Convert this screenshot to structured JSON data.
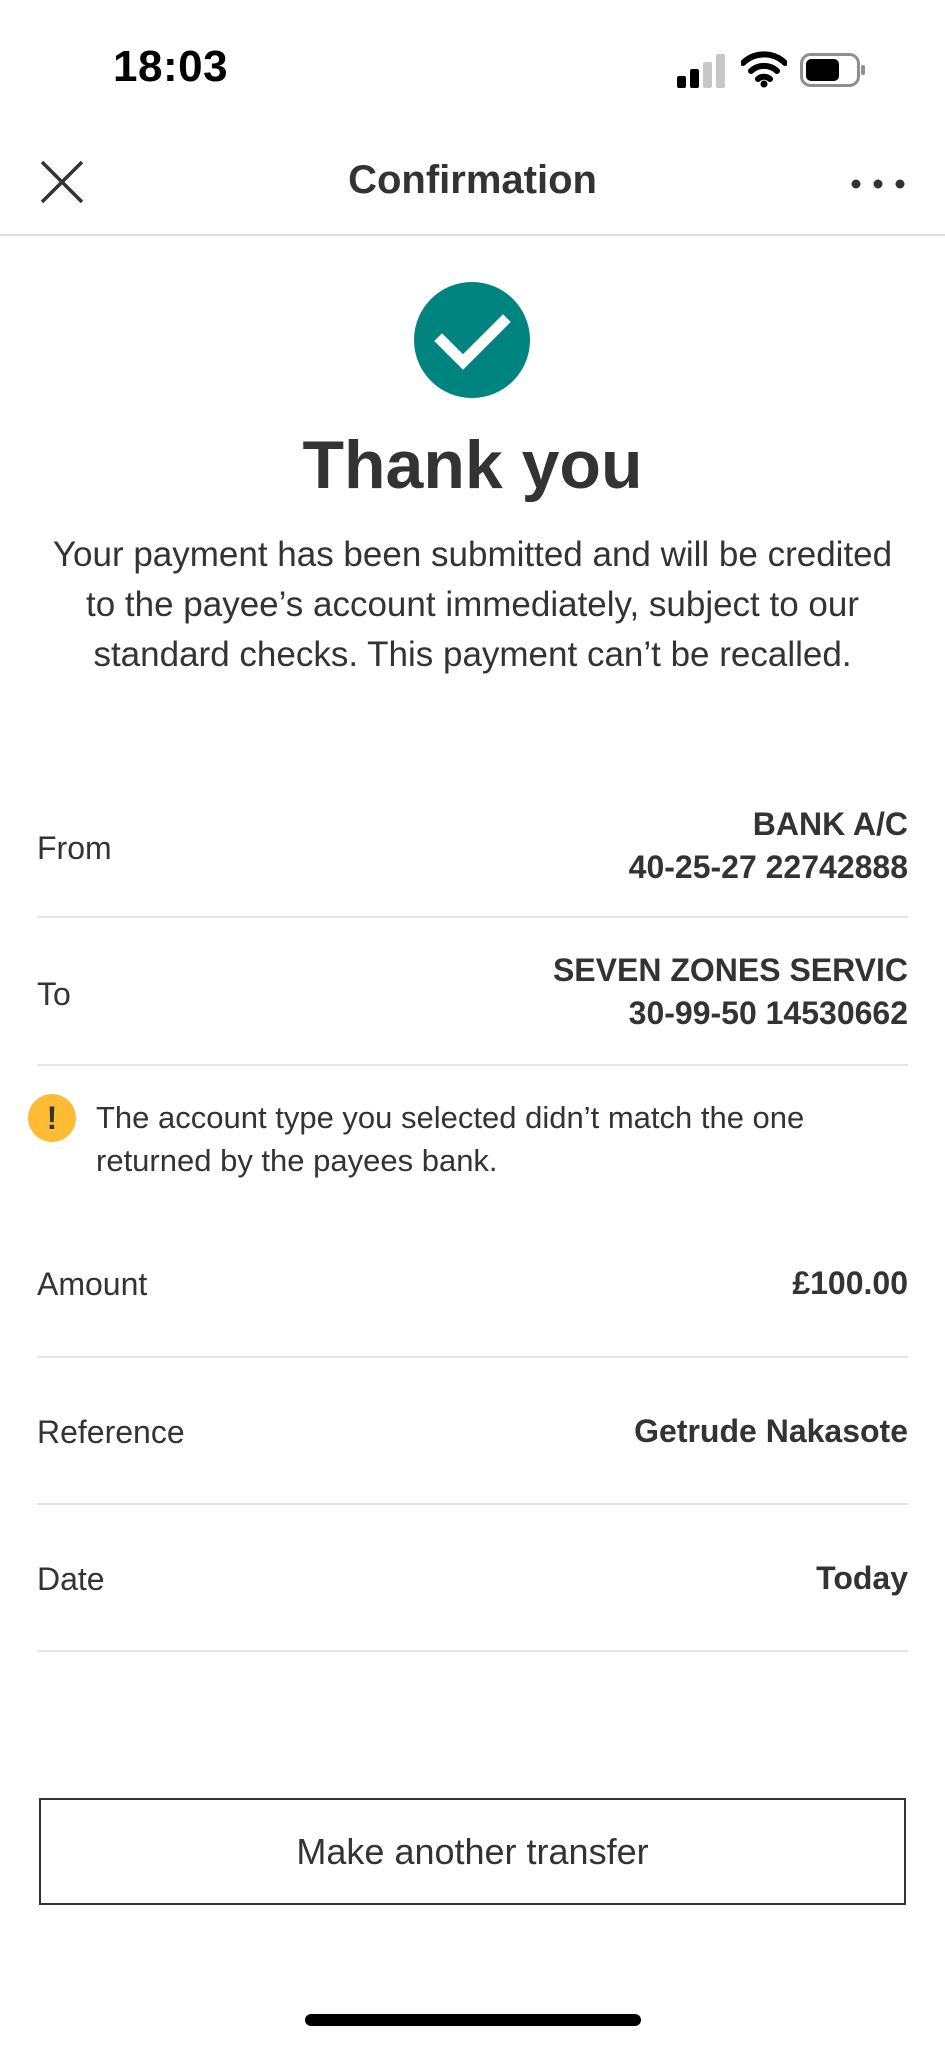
{
  "status_bar": {
    "time": "18:03",
    "signal_icon": "cellular-signal-icon",
    "wifi_icon": "wifi-icon",
    "battery_icon": "battery-icon"
  },
  "nav": {
    "title": "Confirmation",
    "close_icon": "close-icon",
    "more_icon": "more-options-icon"
  },
  "success": {
    "icon": "checkmark-icon",
    "icon_color": "#00847f",
    "heading": "Thank you",
    "message": "Your payment has been submitted and will be credited to the payee’s account immediately, subject to our standard checks. This payment can’t be recalled."
  },
  "details": {
    "from": {
      "label": "From",
      "name": "BANK A/C",
      "account": "40-25-27 22742888"
    },
    "to": {
      "label": "To",
      "name": "SEVEN ZONES SERVIC",
      "account": "30-99-50 14530662"
    },
    "warning": {
      "icon": "warning-icon",
      "icon_color": "#ffbb33",
      "text": "The account type you selected didn’t match the one returned by the payees bank."
    },
    "amount": {
      "label": "Amount",
      "value": "£100.00"
    },
    "reference": {
      "label": "Reference",
      "value": "Getrude Nakasote"
    },
    "date": {
      "label": "Date",
      "value": "Today"
    }
  },
  "actions": {
    "make_another_transfer": "Make another transfer"
  }
}
